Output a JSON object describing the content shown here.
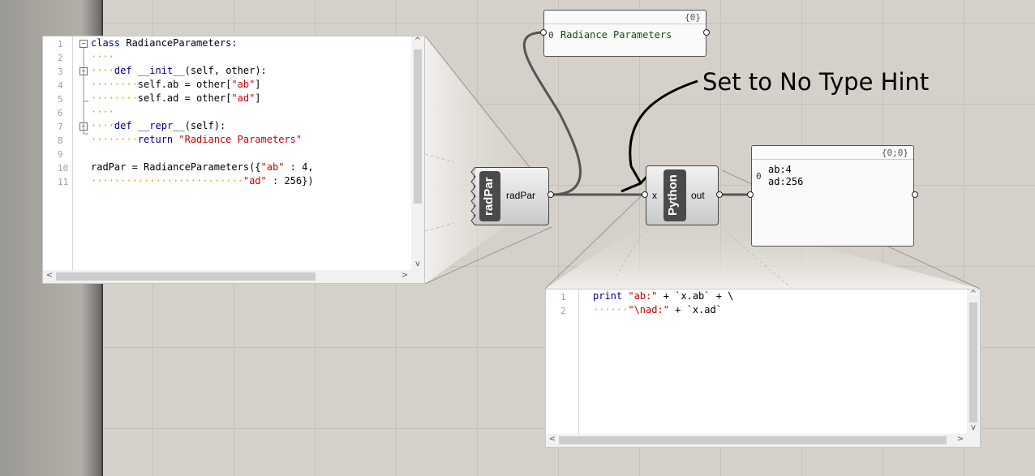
{
  "annotation": "Set to No Type Hint",
  "editor_left": {
    "line_numbers": [
      "1",
      "2",
      "3",
      "4",
      "5",
      "6",
      "7",
      "8",
      "9",
      "10",
      "11"
    ],
    "lines": {
      "l1": {
        "kw": "class",
        "rest": " RadianceParameters:"
      },
      "l2": {
        "dots": "····"
      },
      "l3": {
        "dots": "····",
        "kw": "def",
        "fn": " __init__",
        "rest": "(self, other):"
      },
      "l4": {
        "dots": "········",
        "rest": "self.ab = other[",
        "str": "\"ab\"",
        "end": "]"
      },
      "l5": {
        "dots": "········",
        "rest": "self.ad = other[",
        "str": "\"ad\"",
        "end": "]"
      },
      "l6": {
        "dots": "····"
      },
      "l7": {
        "dots": "····",
        "kw": "def",
        "fn": " __repr__",
        "rest": "(self):"
      },
      "l8": {
        "dots": "········",
        "kw": "return",
        "str": " \"Radiance Parameters\""
      },
      "l10": {
        "rest": "radPar = RadianceParameters({",
        "str1": "\"ab\"",
        "mid": " : 4,"
      },
      "l11": {
        "dots": "··························",
        "str": "\"ad\"",
        "end": " : 256})"
      }
    },
    "fold_markers": [
      "−",
      "−",
      "−"
    ]
  },
  "editor_right": {
    "line_numbers": [
      "1",
      "2"
    ],
    "l1": {
      "kw": "print",
      "str": " \"ab:\"",
      "rest": " + `x.ab` + \\"
    },
    "l2": {
      "dots": "······",
      "str": "\"\\nad:\"",
      "rest": " + `x.ad`"
    }
  },
  "panel_top": {
    "path": "{0}",
    "index": "0",
    "value": "Radiance Parameters"
  },
  "panel_right": {
    "path": "{0;0}",
    "index": "0",
    "value_line1": "ab:4",
    "value_line2": "ad:256"
  },
  "component_radpar": {
    "name": "radPar",
    "output": "radPar"
  },
  "component_python": {
    "name": "Python",
    "input": "x",
    "output": "out"
  },
  "scroll_arrows": {
    "up": "^",
    "down": "v",
    "left": "<",
    "right": ">"
  },
  "colors": {
    "keyword": "#00008b",
    "string": "#c80000",
    "whitespace_dots": "#e0a000",
    "canvas": "#d5d1ca"
  }
}
